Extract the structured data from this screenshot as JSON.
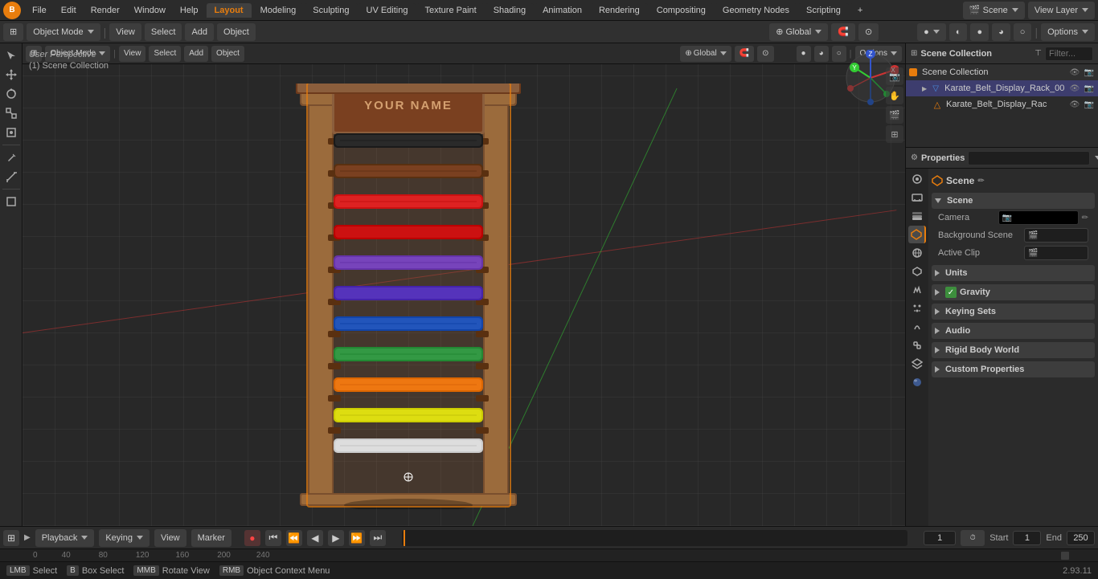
{
  "app": {
    "title": "Blender",
    "version": "2.93.11"
  },
  "top_menu": {
    "logo": "B",
    "items": [
      "File",
      "Edit",
      "Render",
      "Window",
      "Help"
    ]
  },
  "workspace_tabs": {
    "tabs": [
      "Layout",
      "Modeling",
      "Sculpting",
      "UV Editing",
      "Texture Paint",
      "Shading",
      "Animation",
      "Rendering",
      "Compositing",
      "Geometry Nodes",
      "Scripting"
    ],
    "active": "Layout",
    "add_icon": "+"
  },
  "viewport_header": {
    "object_mode": "Object Mode",
    "view": "View",
    "select": "Select",
    "add": "Add",
    "object": "Object",
    "global": "Global",
    "options": "Options"
  },
  "perspective": {
    "label": "User Perspective",
    "collection": "(1) Scene Collection"
  },
  "outliner": {
    "title": "Scene Collection",
    "items": [
      {
        "name": "Karate_Belt_Display_Rack_00",
        "indent": 1,
        "icon": "▶",
        "type": "mesh",
        "visible": true,
        "selected": true
      },
      {
        "name": "Karate_Belt_Display_Rac",
        "indent": 2,
        "icon": "△",
        "type": "object",
        "visible": true,
        "selected": false
      }
    ]
  },
  "properties": {
    "active_tab": "scene",
    "scene_name": "Scene",
    "section_scene": {
      "title": "Scene",
      "subsection_title": "Scene",
      "camera_label": "Camera",
      "camera_value": "",
      "background_scene_label": "Background Scene",
      "active_clip_label": "Active Clip",
      "sections": [
        "Units",
        "Gravity",
        "Keying Sets",
        "Audio",
        "Rigid Body World",
        "Custom Properties"
      ]
    }
  },
  "timeline": {
    "playback_label": "Playback",
    "keying_label": "Keying",
    "view_label": "View",
    "marker_label": "Marker",
    "frame_current": "1",
    "frame_start_label": "Start",
    "frame_start": "1",
    "frame_end_label": "End",
    "frame_end": "250",
    "timeline_ticks": [
      "0",
      "40",
      "80",
      "120",
      "160",
      "200",
      "240"
    ]
  },
  "status_bar": {
    "select_label": "Select",
    "box_select_label": "Box Select",
    "rotate_view_label": "Rotate View",
    "object_context_label": "Object Context Menu",
    "version": "2.93.11"
  },
  "left_tools": [
    {
      "name": "cursor",
      "icon": "+",
      "active": false
    },
    {
      "name": "move",
      "icon": "⊕",
      "active": false
    },
    {
      "name": "rotate",
      "icon": "↻",
      "active": false
    },
    {
      "name": "scale",
      "icon": "⤢",
      "active": false
    },
    {
      "name": "transform",
      "icon": "⊞",
      "active": false
    },
    {
      "name": "annotate",
      "icon": "✏",
      "active": false
    },
    {
      "name": "measure",
      "icon": "📏",
      "active": false
    },
    {
      "name": "add-cube",
      "icon": "◻",
      "active": false
    }
  ],
  "viewport_overlays": [
    {
      "name": "camera",
      "icon": "📷"
    },
    {
      "name": "hand",
      "icon": "✋"
    },
    {
      "name": "movie",
      "icon": "🎬"
    },
    {
      "name": "grid",
      "icon": "⊞"
    }
  ],
  "colors": {
    "accent": "#e87d0d",
    "bg_dark": "#1e1e1e",
    "bg_medium": "#2b2b2b",
    "bg_light": "#303030",
    "selected": "#3d3d6e",
    "axis_x": "#cc3333",
    "axis_y": "#33cc33",
    "axis_z": "#3333cc"
  }
}
